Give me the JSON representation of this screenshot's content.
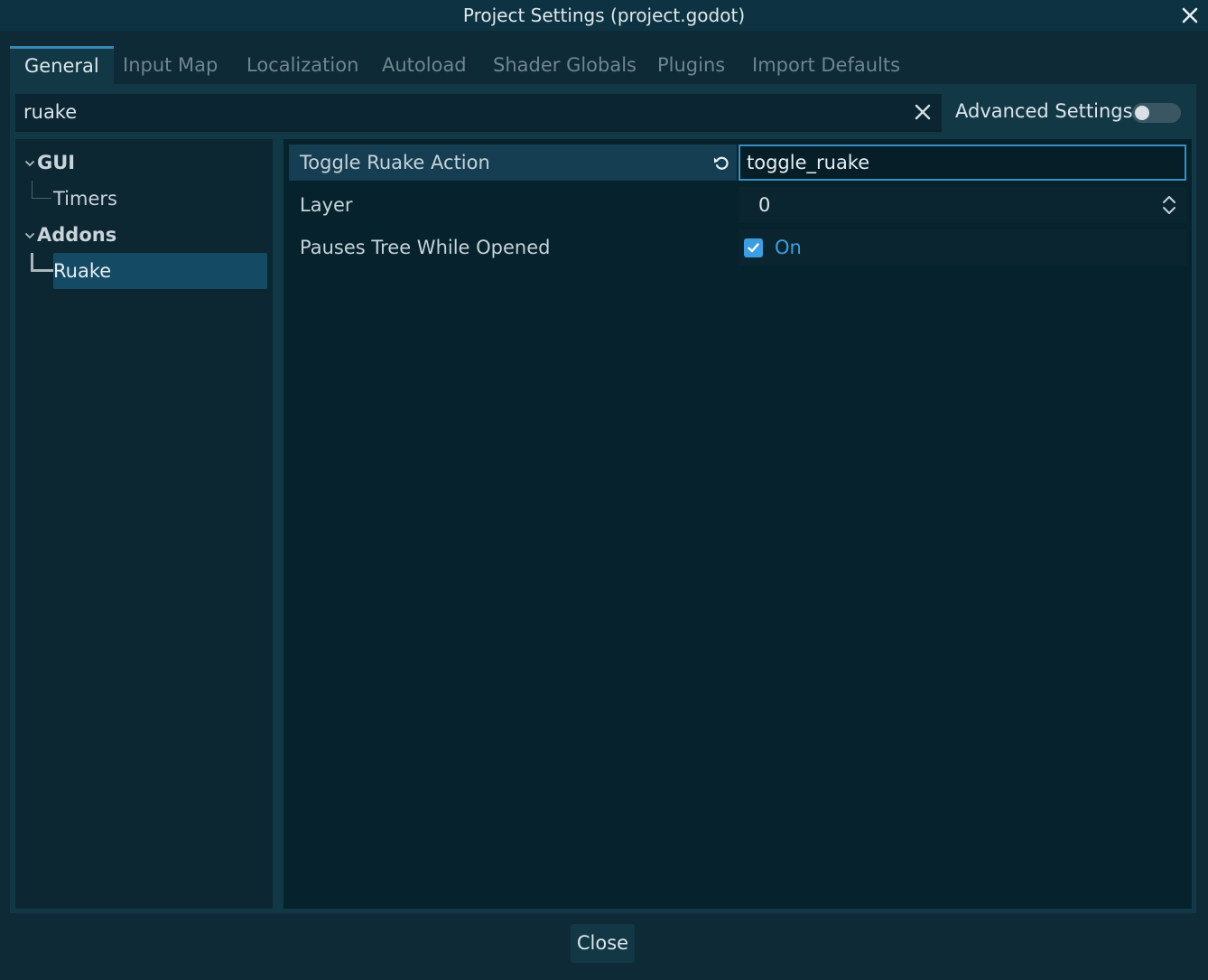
{
  "window": {
    "title": "Project Settings (project.godot)",
    "close_icon": "close-icon"
  },
  "tabs": [
    {
      "label": "General",
      "active": true
    },
    {
      "label": "Input Map",
      "active": false
    },
    {
      "label": "Localization",
      "active": false
    },
    {
      "label": "Autoload",
      "active": false
    },
    {
      "label": "Shader Globals",
      "active": false
    },
    {
      "label": "Plugins",
      "active": false
    },
    {
      "label": "Import Defaults",
      "active": false
    }
  ],
  "search": {
    "value": "ruake",
    "clear_icon": "clear-icon"
  },
  "advanced_settings": {
    "label": "Advanced Settings",
    "enabled": false
  },
  "tree": {
    "sections": [
      {
        "label": "GUI",
        "expanded": true,
        "items": [
          {
            "label": "Timers",
            "selected": false
          }
        ]
      },
      {
        "label": "Addons",
        "expanded": true,
        "items": [
          {
            "label": "Ruake",
            "selected": true
          }
        ]
      }
    ]
  },
  "properties": [
    {
      "name": "Toggle Ruake Action",
      "type": "text",
      "value": "toggle_ruake",
      "revertable": true
    },
    {
      "name": "Layer",
      "type": "number",
      "value": "0"
    },
    {
      "name": "Pauses Tree While Opened",
      "type": "bool",
      "checked": true,
      "value_label": "On"
    }
  ],
  "footer": {
    "close_label": "Close"
  },
  "colors": {
    "accent": "#3c9ee0",
    "selection": "#154a64",
    "background": "#0e2a36"
  }
}
